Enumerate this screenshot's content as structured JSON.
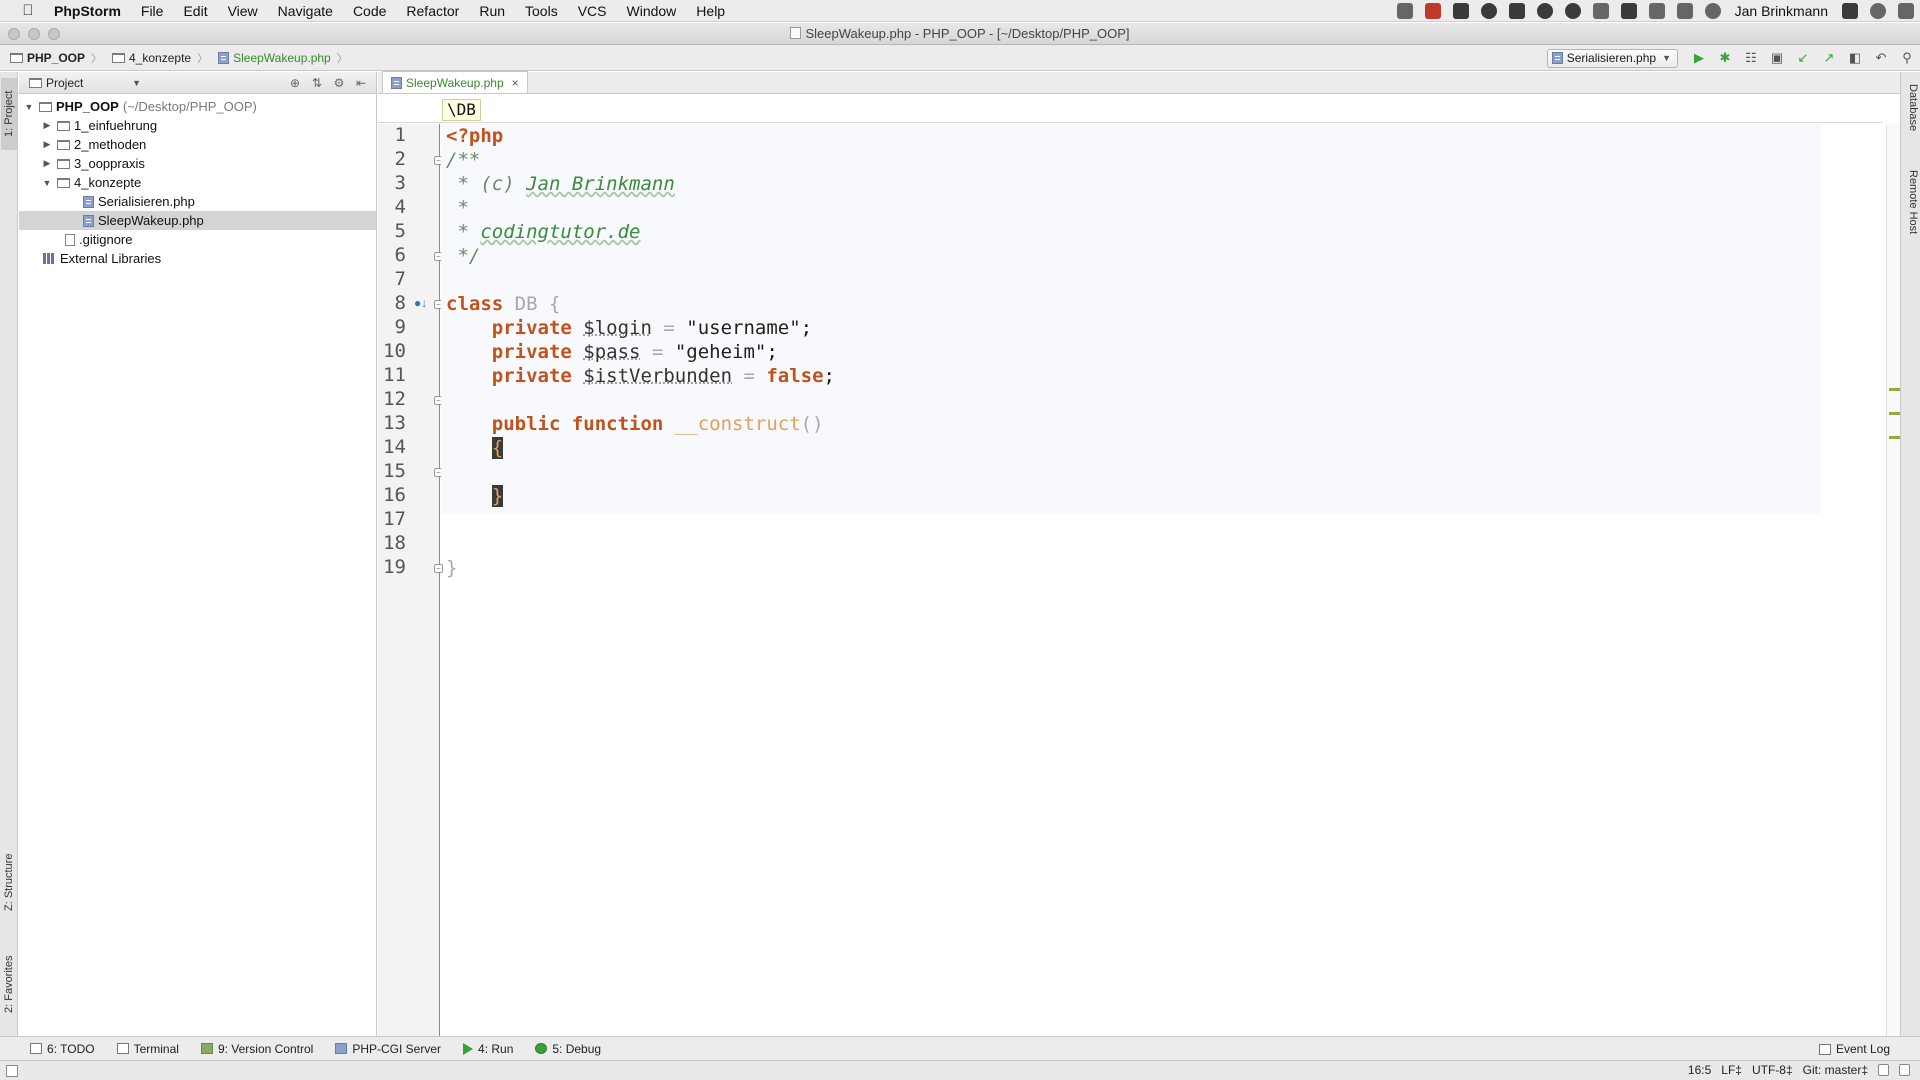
{
  "menubar": {
    "app_name": "PhpStorm",
    "items": [
      "File",
      "Edit",
      "View",
      "Navigate",
      "Code",
      "Refactor",
      "Run",
      "Tools",
      "VCS",
      "Window",
      "Help"
    ],
    "user": "Jan Brinkmann"
  },
  "window": {
    "title": "SleepWakeup.php - PHP_OOP - [~/Desktop/PHP_OOP]"
  },
  "navbar": {
    "crumbs": [
      "PHP_OOP",
      "4_konzepte",
      "SleepWakeup.php"
    ],
    "run_config": "Serialisieren.php"
  },
  "left_strip": {
    "project_tab": "1: Project",
    "structure_tab": "Z: Structure",
    "favorites_tab": "2: Favorites"
  },
  "right_strip": {
    "database_tab": "Database",
    "remote_host_tab": "Remote Host"
  },
  "project_panel": {
    "dropdown_label": "Project",
    "tree": {
      "root_label": "PHP_OOP",
      "root_path": "(~/Desktop/PHP_OOP)",
      "folders": [
        "1_einfuehrung",
        "2_methoden",
        "3_ooppraxis",
        "4_konzepte"
      ],
      "files": [
        "Serialisieren.php",
        "SleepWakeup.php"
      ],
      "gitignore": ".gitignore",
      "external_libraries": "External Libraries"
    }
  },
  "editor": {
    "tab_label": "SleepWakeup.php",
    "class_breadcrumb": "\\DB",
    "line_numbers": [
      "1",
      "2",
      "3",
      "4",
      "5",
      "6",
      "7",
      "8",
      "9",
      "10",
      "11",
      "12",
      "13",
      "14",
      "15",
      "16",
      "17",
      "18",
      "19"
    ],
    "code": {
      "l1": "<?php",
      "l2": "/**",
      "l3_prefix": " * (c) ",
      "l3_author": "Jan Brinkmann",
      "l4": " *",
      "l5_prefix": " * ",
      "l5_site": "codingtutor.de",
      "l6": " */",
      "l8_kw": "class",
      "l8_name": " DB {",
      "private_kw": "private",
      "l9_var": "$login",
      "l9_eq": " = ",
      "l9_val": "\"username\"",
      "semicolon": ";",
      "l10_var": "$pass",
      "l10_val": "\"geheim\"",
      "l11_var": "$istVerbunden",
      "l11_val": "false",
      "l13_public": "public",
      "l13_function": "function",
      "l13_name": "__construct",
      "l13_parens": "()",
      "open_brace": "{",
      "close_brace": "}",
      "l19": "}"
    }
  },
  "bottom_bar": {
    "todo": "6: TODO",
    "terminal": "Terminal",
    "version_control": "9: Version Control",
    "php_cgi": "PHP-CGI Server",
    "run": "4: Run",
    "debug": "5: Debug",
    "event_log": "Event Log"
  },
  "status_bar": {
    "position": "16:5",
    "line_sep": "LF‡",
    "encoding": "UTF-8‡",
    "git_branch": "Git: master‡"
  }
}
